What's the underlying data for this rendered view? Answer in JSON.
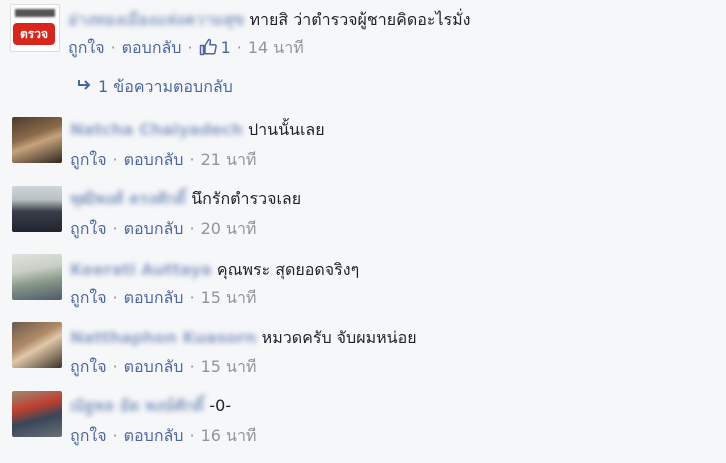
{
  "comments": [
    {
      "author": "อ่างทองเมืองแห่งความสุข",
      "text": "ทายสิ ว่าตำรวจผู้ชายคิดอะไรมั่ง",
      "avatar_label": "ตรวจ",
      "like_label": "ถูกใจ",
      "reply_label": "ตอบกลับ",
      "likes": "1",
      "time": "14 นาที"
    },
    {
      "author": "Natcha Chaiyadech",
      "text": "ปานนั้นเลย",
      "like_label": "ถูกใจ",
      "reply_label": "ตอบกลับ",
      "time": "21 นาที"
    },
    {
      "author": "พุฒิพงศ์ ตรงศักดิ์",
      "text": "นึกรักตำรวจเลย",
      "like_label": "ถูกใจ",
      "reply_label": "ตอบกลับ",
      "time": "20 นาที"
    },
    {
      "author": "Keerati Auttaya",
      "text": "คุณพระ สุดยอดจริงๆ",
      "like_label": "ถูกใจ",
      "reply_label": "ตอบกลับ",
      "time": "15 นาที"
    },
    {
      "author": "Natthaphon Kuasorn",
      "text": "หมวดครับ จับผมหน่อย",
      "like_label": "ถูกใจ",
      "reply_label": "ตอบกลับ",
      "time": "15 นาที"
    },
    {
      "author": "ณัฐพล อัด พงษ์ศักดิ์",
      "text": "-0-",
      "like_label": "ถูกใจ",
      "reply_label": "ตอบกลับ",
      "time": "16 นาที"
    }
  ],
  "reply_thread": {
    "label": "1 ข้อความตอบกลับ"
  },
  "colors": {
    "link": "#4b67a1",
    "meta": "#90949c",
    "text": "#1d2129",
    "background": "#f6f7f9"
  },
  "icons": {
    "like": "thumbs-up-icon",
    "reply_arrow": "reply-arrow-icon"
  }
}
